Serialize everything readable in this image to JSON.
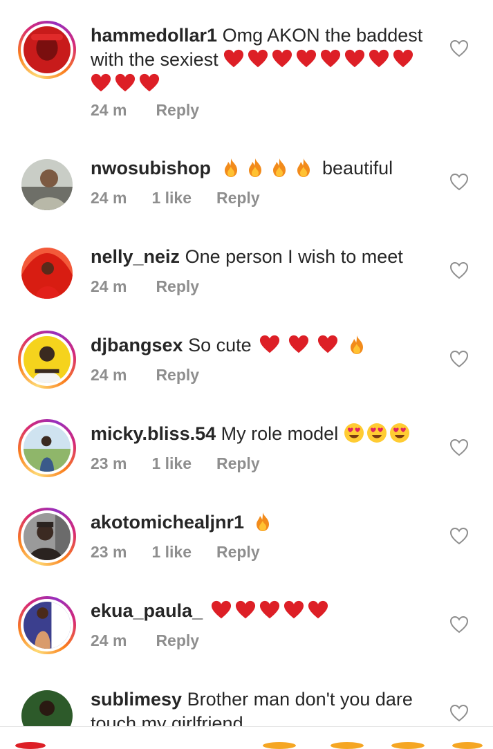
{
  "comments": [
    {
      "username": "hammedollar1",
      "text": "Omg AKON the baddest with the sexiest",
      "emojis": [
        "heart",
        "heart",
        "heart",
        "heart",
        "heart",
        "heart",
        "heart",
        "heart",
        "heart",
        "heart",
        "heart"
      ],
      "time": "24 m",
      "likes": "",
      "reply": "Reply",
      "avatar_colors": [
        "#c81b1b",
        "#7a0f0f"
      ],
      "ring": true
    },
    {
      "username": "nwosubishop",
      "text_after_emojis": "beautiful",
      "emojis": [
        "fire",
        "fire",
        "fire",
        "fire"
      ],
      "time": "24 m",
      "likes": "1 like",
      "reply": "Reply",
      "avatar_colors": [
        "#6e6f68",
        "#c9cdc6"
      ],
      "ring": false
    },
    {
      "username": "nelly_neiz",
      "text": "One person I wish to meet",
      "emojis": [],
      "time": "24 m",
      "likes": "",
      "reply": "Reply",
      "avatar_colors": [
        "#d81d12",
        "#f35a3a"
      ],
      "ring": false
    },
    {
      "username": "djbangsex",
      "text": "So cute",
      "emojis": [
        "heart",
        "heart",
        "heart",
        "fire"
      ],
      "time": "24 m",
      "likes": "",
      "reply": "Reply",
      "avatar_colors": [
        "#f5d31d",
        "#3a2a20"
      ],
      "ring": true
    },
    {
      "username": "micky.bliss.54",
      "text": "My role model",
      "emojis": [
        "heart-eyes",
        "heart-eyes",
        "heart-eyes"
      ],
      "time": "23 m",
      "likes": "1 like",
      "reply": "Reply",
      "avatar_colors": [
        "#8fb66a",
        "#3a5a8a"
      ],
      "ring": true
    },
    {
      "username": "akotomichealjnr1",
      "text": "",
      "emojis": [
        "fire"
      ],
      "time": "23 m",
      "likes": "1 like",
      "reply": "Reply",
      "avatar_colors": [
        "#6b6b6b",
        "#2a2320"
      ],
      "ring": true
    },
    {
      "username": "ekua_paula_",
      "text": "",
      "emojis": [
        "heart",
        "heart",
        "heart",
        "heart",
        "heart"
      ],
      "time": "24 m",
      "likes": "",
      "reply": "Reply",
      "avatar_colors": [
        "#3b3f8e",
        "#d99b6c"
      ],
      "ring": true
    },
    {
      "username": "sublimesy",
      "text": "Brother man don't you dare touch my girlfriend",
      "emojis": [],
      "time": "",
      "likes": "",
      "reply": "",
      "avatar_colors": [
        "#2d5a2a",
        "#c9782c"
      ],
      "ring": false
    }
  ]
}
